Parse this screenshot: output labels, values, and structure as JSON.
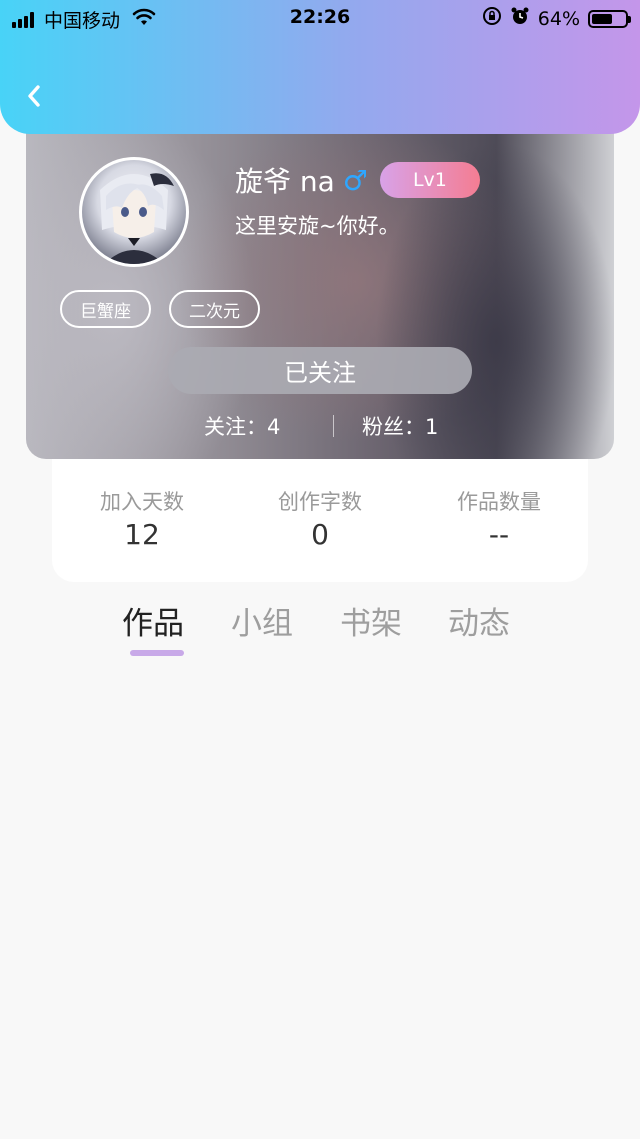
{
  "status_bar": {
    "carrier": "中国移动",
    "time": "22:26",
    "battery": "64%"
  },
  "colors": {
    "header_gradient": [
      "#48d3f7",
      "#c496ea"
    ],
    "accent": "#c8a9e8",
    "gender": "#2ea7ff"
  },
  "profile": {
    "name": "旋爷 na",
    "gender_symbol": "♂",
    "level": "Lv1",
    "bio": "这里安旋~你好。",
    "tags": [
      "巨蟹座",
      "二次元"
    ],
    "follow_button": "已关注",
    "following_label": "关注：4",
    "fans_label": "粉丝：1"
  },
  "stats": [
    {
      "label": "加入天数",
      "value": "12"
    },
    {
      "label": "创作字数",
      "value": "0"
    },
    {
      "label": "作品数量",
      "value": "--"
    }
  ],
  "tabs": [
    {
      "label": "作品",
      "active": true
    },
    {
      "label": "小组",
      "active": false
    },
    {
      "label": "书架",
      "active": false
    },
    {
      "label": "动态",
      "active": false
    }
  ]
}
